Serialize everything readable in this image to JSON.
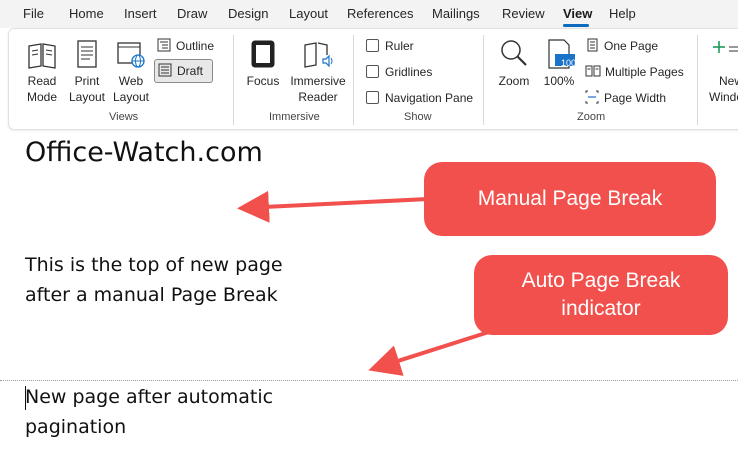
{
  "menubar": {
    "file": "File",
    "home": "Home",
    "insert": "Insert",
    "draw": "Draw",
    "design": "Design",
    "layout": "Layout",
    "references": "References",
    "mailings": "Mailings",
    "review": "Review",
    "view": "View",
    "help": "Help"
  },
  "ribbon": {
    "views": {
      "read_mode_l1": "Read",
      "read_mode_l2": "Mode",
      "print_layout_l1": "Print",
      "print_layout_l2": "Layout",
      "web_layout_l1": "Web",
      "web_layout_l2": "Layout",
      "outline": "Outline",
      "draft": "Draft",
      "group_label": "Views"
    },
    "immersive": {
      "focus": "Focus",
      "immersive_reader_l1": "Immersive",
      "immersive_reader_l2": "Reader",
      "group_label": "Immersive"
    },
    "show": {
      "ruler": "Ruler",
      "gridlines": "Gridlines",
      "navigation_pane": "Navigation Pane",
      "group_label": "Show"
    },
    "zoom": {
      "zoom": "Zoom",
      "zoom_100": "100%",
      "zoom_100_icon_text": "100",
      "one_page": "One Page",
      "multiple_pages": "Multiple Pages",
      "page_width": "Page Width",
      "group_label": "Zoom"
    },
    "window": {
      "new_window_l1": "New",
      "new_window_l2": "Windo"
    }
  },
  "document": {
    "heading": "Office-Watch.com",
    "para1_l1": "This is the top of new page",
    "para1_l2": "after a manual Page Break",
    "para2_l1": "New page after automatic",
    "para2_l2": "pagination"
  },
  "callouts": {
    "manual": "Manual Page Break",
    "auto": "Auto Page Break\nindicator"
  },
  "colors": {
    "callout": "#f2504d",
    "accent": "#0f6cbd"
  }
}
